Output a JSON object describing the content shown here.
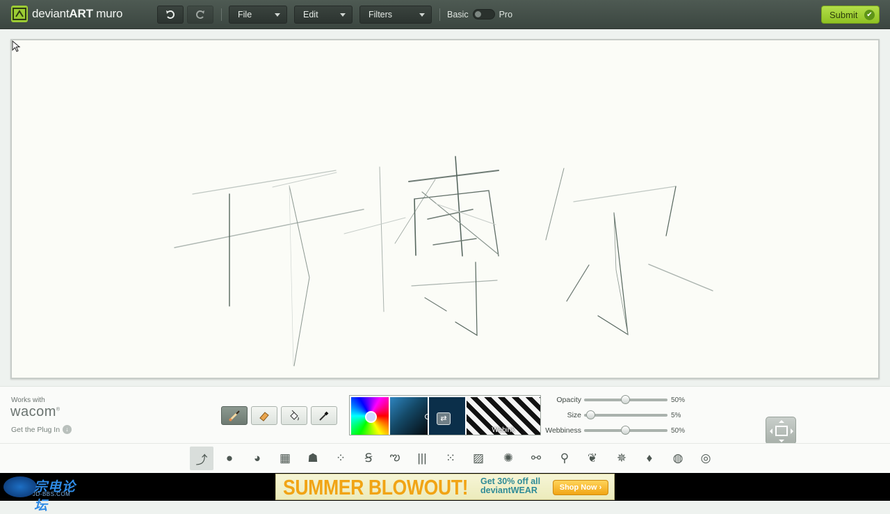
{
  "app": {
    "title_regular": "deviant",
    "title_bold": "ART",
    "title_tail": " muro"
  },
  "toolbar": {
    "undo_icon": "undo-icon",
    "redo_icon": "redo-icon",
    "menus": [
      "File",
      "Edit",
      "Filters"
    ],
    "mode_basic": "Basic",
    "mode_pro": "Pro",
    "submit": "Submit"
  },
  "wacom": {
    "works_with": "Works with",
    "brand": "wacom",
    "plugin": "Get the Plug In"
  },
  "tools": [
    "brush-icon",
    "eraser-icon",
    "fill-bucket-icon",
    "eyedropper-icon"
  ],
  "palette": {
    "pattern_label": "Webink"
  },
  "sliders": [
    {
      "name": "Opacity",
      "value": "50%",
      "level": 0.5
    },
    {
      "name": "Size",
      "value": "5%",
      "level": 0.05
    },
    {
      "name": "Webbiness",
      "value": "50%",
      "level": 0.5
    }
  ],
  "brushes": [
    "pen-icon",
    "round-brush-icon",
    "pie-brush-icon",
    "crosshatch-icon",
    "ink-drop-icon",
    "splatter-icon",
    "spiral-icon",
    "squiggle-icon",
    "lines-icon",
    "dots-icon",
    "hatch-icon",
    "starburst-icon",
    "chain-icon",
    "rings-icon",
    "feather-icon",
    "sparkle-icon",
    "drop-icon",
    "noise-ball-icon",
    "texture-ball-icon"
  ],
  "site": {
    "name": "宗电论坛",
    "url_text": "JD-BBS.COM"
  },
  "ad": {
    "headline": "SUMMER BLOWOUT!",
    "promo_line1": "Get 30% off all",
    "promo_line2": "deviantWEAR",
    "cta": "Shop Now ›"
  },
  "colors": {
    "accent_green": "#9ccc34",
    "topbar": "#434e48",
    "canvas": "#fbfcf7"
  }
}
